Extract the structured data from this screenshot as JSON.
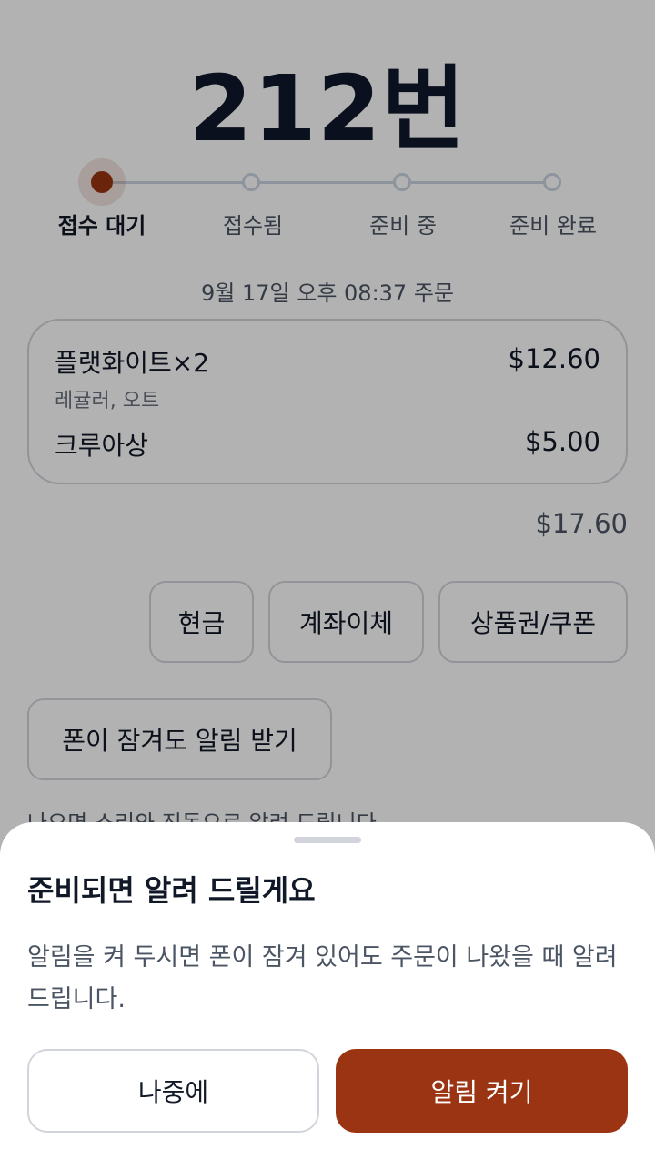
{
  "order": {
    "number": "212번",
    "time": "9월 17일 오후 08:37 주문"
  },
  "progress": {
    "steps": [
      {
        "label": "접수 대기",
        "active": true
      },
      {
        "label": "접수됨",
        "active": false
      },
      {
        "label": "준비 중",
        "active": false
      },
      {
        "label": "준비 완료",
        "active": false
      }
    ]
  },
  "items": [
    {
      "name": "플랫화이트×2",
      "options": "레귤러, 오트",
      "price": "$12.60"
    },
    {
      "name": "크루아상",
      "options": "",
      "price": "$5.00"
    }
  ],
  "total": "$17.60",
  "payment": {
    "cash": "현금",
    "transfer": "계좌이체",
    "voucher": "상품권/쿠폰"
  },
  "notify": {
    "button_label": "폰이 잠겨도 알림 받기",
    "hint": "나오면 소리와 진동으로 알려 드립니다."
  },
  "sheet": {
    "title": "준비되면 알려 드릴게요",
    "body": "알림을 켜 두시면 폰이 잠겨 있어도 주문이 나왔을 때 알려 드립니다.",
    "later_label": "나중에",
    "enable_label": "알림 켜기"
  },
  "colors": {
    "accent": "#9a3412",
    "text": "#111827",
    "muted": "#4b5563",
    "border": "#d1d5db"
  }
}
